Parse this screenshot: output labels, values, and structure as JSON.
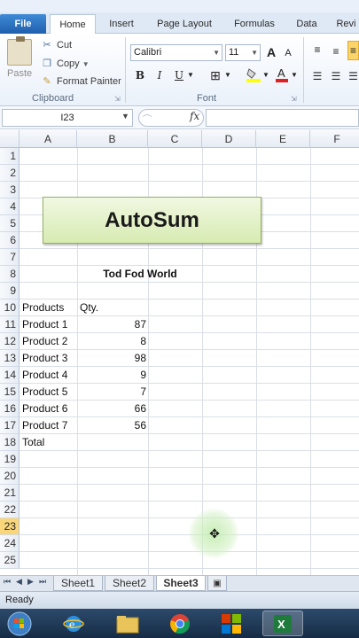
{
  "ribbon": {
    "tabs": [
      "File",
      "Home",
      "Insert",
      "Page Layout",
      "Formulas",
      "Data",
      "Revi"
    ],
    "active_tab": "Home",
    "clipboard": {
      "paste_label": "Paste",
      "cut_label": "Cut",
      "copy_label": "Copy",
      "format_painter_label": "Format Painter",
      "group_label": "Clipboard"
    },
    "font": {
      "name": "Calibri",
      "size": "11",
      "group_label": "Font",
      "bold": "B",
      "italic": "I",
      "underline": "U",
      "grow": "A",
      "shrink": "A"
    }
  },
  "formula_bar": {
    "name_box": "I23",
    "fx_label": "fx",
    "value": ""
  },
  "grid": {
    "columns": [
      "A",
      "B",
      "C",
      "D",
      "E",
      "F"
    ],
    "rows": [
      "1",
      "2",
      "3",
      "4",
      "5",
      "6",
      "7",
      "8",
      "9",
      "10",
      "11",
      "12",
      "13",
      "14",
      "15",
      "16",
      "17",
      "18",
      "19",
      "20",
      "21",
      "22",
      "23",
      "24",
      "25"
    ],
    "selected_row": "23",
    "title_shape": "AutoSum",
    "heading": "Tod Fod World",
    "header_products": "Products",
    "header_qty": "Qty.",
    "products": [
      {
        "name": "Product 1",
        "qty": "87"
      },
      {
        "name": "Product 2",
        "qty": "8"
      },
      {
        "name": "Product 3",
        "qty": "98"
      },
      {
        "name": "Product 4",
        "qty": "9"
      },
      {
        "name": "Product 5",
        "qty": "7"
      },
      {
        "name": "Product 6",
        "qty": "66"
      },
      {
        "name": "Product 7",
        "qty": "56"
      }
    ],
    "total_label": "Total"
  },
  "sheets": {
    "tabs": [
      "Sheet1",
      "Sheet2",
      "Sheet3"
    ],
    "active": "Sheet3"
  },
  "status": {
    "text": "Ready"
  },
  "colors": {
    "accent_file_tab": "#2a6ebf",
    "shape_fill": "#e2f0c8",
    "selected_row_header": "#f9d67a"
  }
}
